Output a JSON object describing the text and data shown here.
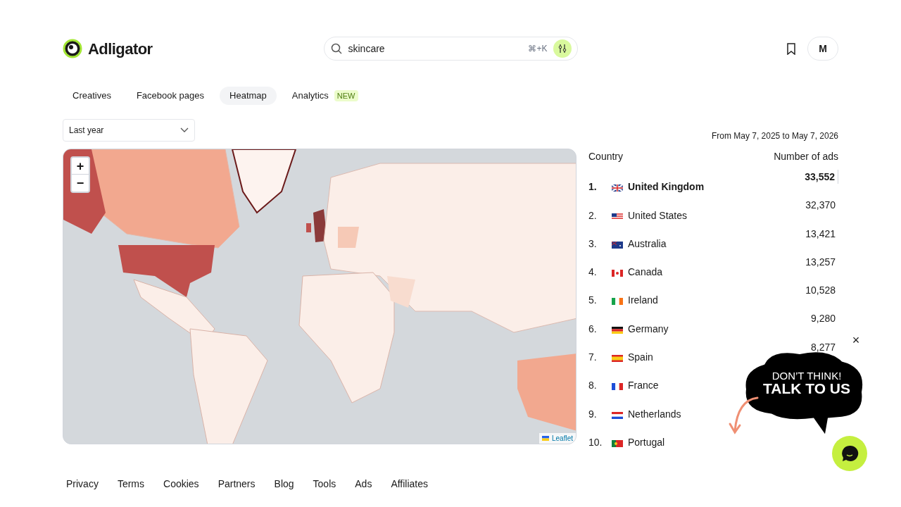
{
  "logo": {
    "text": "Adligator"
  },
  "search": {
    "value": "skincare",
    "shortcut": "⌘+K"
  },
  "profile": {
    "initial": "M"
  },
  "tabs": [
    {
      "label": "Creatives",
      "selected": false
    },
    {
      "label": "Facebook pages",
      "selected": false
    },
    {
      "label": "Heatmap",
      "selected": true
    },
    {
      "label": "Analytics",
      "selected": false,
      "badge": "NEW"
    }
  ],
  "period": {
    "value": "Last year"
  },
  "date_range": "From May 7, 2025 to May 7, 2026",
  "map": {
    "zoom_in": "+",
    "zoom_out": "−",
    "attribution": "Leaflet"
  },
  "table": {
    "columns": [
      "Country",
      "Number of ads"
    ],
    "rows": [
      {
        "rank": "1.",
        "country": "United Kingdom",
        "count": "33,552",
        "selected": true,
        "kind": "gb"
      },
      {
        "rank": "2.",
        "country": "United States",
        "count": "32,370",
        "selected": false,
        "kind": "us"
      },
      {
        "rank": "3.",
        "country": "Australia",
        "count": "13,421",
        "selected": false,
        "kind": "au"
      },
      {
        "rank": "4.",
        "country": "Canada",
        "count": "13,257",
        "selected": false,
        "kind": "ca"
      },
      {
        "rank": "5.",
        "country": "Ireland",
        "count": "10,528",
        "selected": false,
        "kind": "ie"
      },
      {
        "rank": "6.",
        "country": "Germany",
        "count": "9,280",
        "selected": false,
        "kind": "de"
      },
      {
        "rank": "7.",
        "country": "Spain",
        "count": "8,277",
        "selected": false,
        "kind": "es"
      },
      {
        "rank": "8.",
        "country": "France",
        "selected": false,
        "kind": "fr"
      },
      {
        "rank": "9.",
        "country": "Netherlands",
        "selected": false,
        "kind": "nl"
      },
      {
        "rank": "10.",
        "country": "Portugal",
        "selected": false,
        "kind": "pt"
      }
    ]
  },
  "chat_promo": {
    "line_1": "DON’T THINK!",
    "line_2": "TALK TO US",
    "close": "×"
  },
  "footer": [
    "Privacy",
    "Terms",
    "Cookies",
    "Partners",
    "Blog",
    "Tools",
    "Ads",
    "Affiliates"
  ]
}
